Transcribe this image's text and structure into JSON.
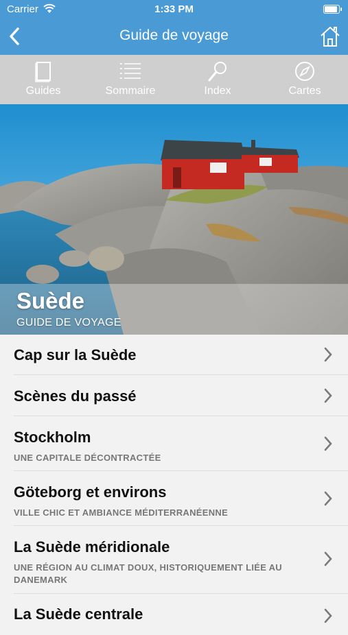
{
  "status": {
    "carrier": "Carrier",
    "time": "1:33 PM",
    "battery_level": 1.0
  },
  "nav": {
    "title": "Guide de voyage",
    "back_icon": "back-chevron-icon",
    "home_icon": "home-icon"
  },
  "toolbar": {
    "items": [
      {
        "label": "Guides",
        "icon": "book-icon"
      },
      {
        "label": "Sommaire",
        "icon": "list-icon"
      },
      {
        "label": "Index",
        "icon": "magnifier-icon"
      },
      {
        "label": "Cartes",
        "icon": "compass-icon"
      }
    ]
  },
  "hero": {
    "title": "Suède",
    "subtitle": "GUIDE DE VOYAGE"
  },
  "sections": [
    {
      "title": "Cap sur la Suède",
      "subtitle": ""
    },
    {
      "title": "Scènes du passé",
      "subtitle": ""
    },
    {
      "title": "Stockholm",
      "subtitle": "UNE CAPITALE DÉCONTRACTÉE"
    },
    {
      "title": "Göteborg et environs",
      "subtitle": "VILLE CHIC ET AMBIANCE MÉDITERRANÉENNE"
    },
    {
      "title": "La Suède méridionale",
      "subtitle": "UNE RÉGION AU CLIMAT DOUX, HISTORIQUEMENT LIÉE AU DANEMARK"
    },
    {
      "title": "La Suède centrale",
      "subtitle": ""
    }
  ],
  "colors": {
    "bar": "#4a9ad6",
    "toolbar": "#cfcfcf",
    "list_bg": "#f2f2f2"
  }
}
